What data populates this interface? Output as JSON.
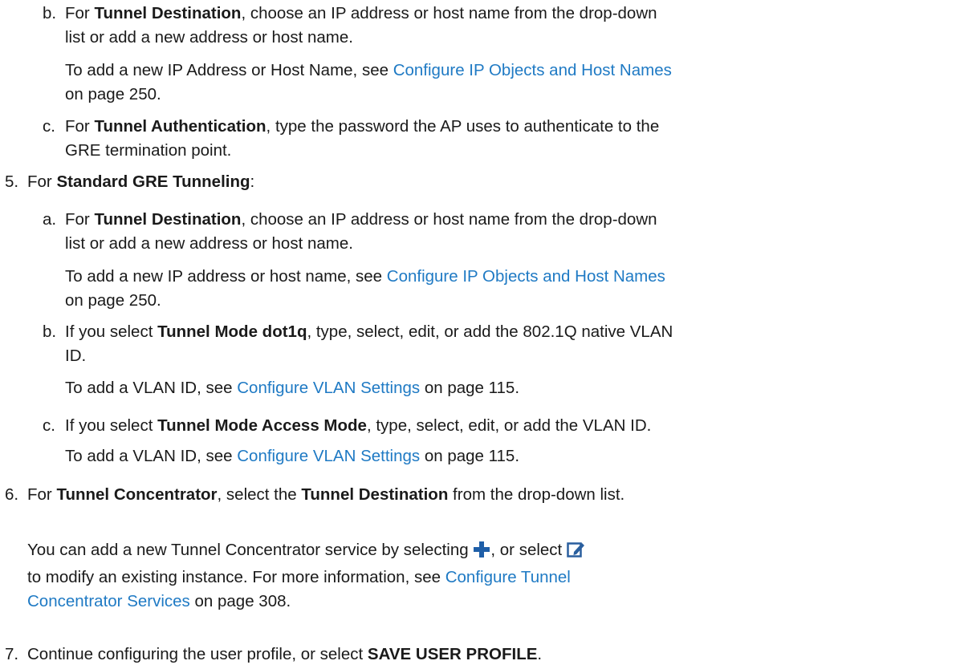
{
  "steps": {
    "s4b": {
      "marker": "b.",
      "pre": "For ",
      "bold": "Tunnel Destination",
      "post": ", choose an IP address or host name from the drop-down",
      "line2": "list or add a new address or host name.",
      "note_pre": "To add a new IP Address or Host Name, see ",
      "note_link": "Configure IP Objects and Host Names",
      "note_post": "on page 250."
    },
    "s4c": {
      "marker": "c.",
      "pre": "For ",
      "bold": "Tunnel Authentication",
      "post": ", type the password the AP uses to authenticate to the",
      "line2": "GRE termination point."
    },
    "s5": {
      "marker": "5.",
      "pre": "For ",
      "bold": "Standard GRE Tunneling",
      "post": ":"
    },
    "s5a": {
      "marker": "a.",
      "pre": "For ",
      "bold": "Tunnel Destination",
      "post": ", choose an IP address or host name from the drop-down",
      "line2": "list or add a new address or host name.",
      "note_pre": "To add a new IP address or host name, see ",
      "note_link": "Configure IP Objects and Host Names",
      "note_post": "on page 250."
    },
    "s5b": {
      "marker": "b.",
      "pre": "If you select ",
      "bold": "Tunnel Mode dot1q",
      "post": ", type, select, edit, or add the 802.1Q native VLAN",
      "line2": "ID.",
      "note_pre": "To add a VLAN ID, see ",
      "note_link": "Configure VLAN Settings",
      "note_post": " on page 115."
    },
    "s5c": {
      "marker": "c.",
      "pre": "If you select ",
      "bold": "Tunnel Mode Access Mode",
      "post": ", type, select, edit, or add the VLAN ID.",
      "note_pre": "To add a VLAN ID, see ",
      "note_link": "Configure VLAN Settings",
      "note_post": " on page 115."
    },
    "s6": {
      "marker": "6.",
      "pre": "For ",
      "bold": "Tunnel Concentrator",
      "mid": ", select the ",
      "bold2": "Tunnel Destination",
      "post": " from the drop-down list.",
      "note_pre": "You can add a new Tunnel Concentrator service by selecting ",
      "note_mid": ", or select ",
      "note_line2": "to modify an existing instance. For more information, see ",
      "note_link": "Configure Tunnel",
      "note_link2": "Concentrator Services",
      "note_post": " on page 308."
    },
    "s7": {
      "marker": "7.",
      "pre": "Continue configuring the user profile, or select ",
      "bold": "SAVE USER PROFILE",
      "post": "."
    }
  },
  "icons": {
    "plus": "plus-icon",
    "edit": "edit-icon",
    "plus_color": "#1f5fa8",
    "edit_color": "#2a5f9e"
  }
}
